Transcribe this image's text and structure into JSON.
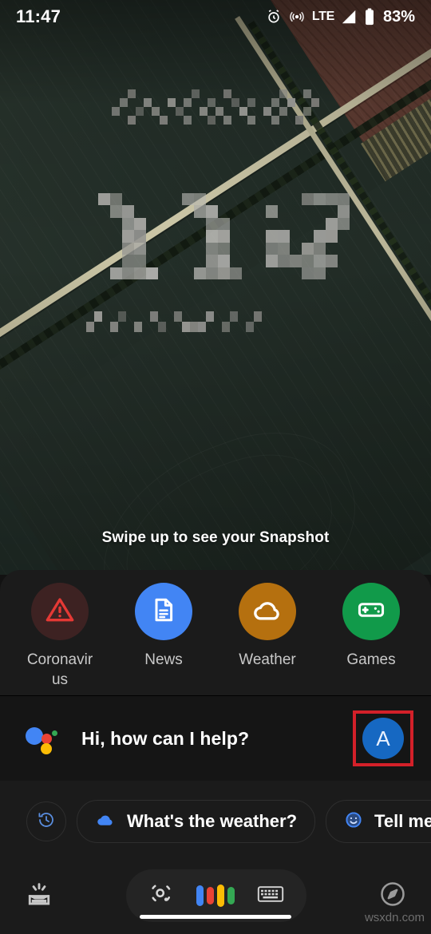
{
  "status_bar": {
    "time": "11:47",
    "battery_percent": "83%",
    "network_label": "LTE",
    "icons": [
      "alarm-icon",
      "hotspot-icon",
      "signal-icon",
      "battery-icon"
    ]
  },
  "lockscreen": {
    "clock_text": "11:47",
    "clock_blurred": true,
    "top_line_blurred": true,
    "bottom_line_blurred": true,
    "snapshot_hint": "Swipe up to see your Snapshot"
  },
  "shortcuts": [
    {
      "label": "Coronavirus",
      "icon": "warning-triangle-icon",
      "circle_color": "#3d2222",
      "icon_color": "#e53935"
    },
    {
      "label": "News",
      "icon": "document-icon",
      "circle_color": "#4285f4",
      "icon_color": "#ffffff"
    },
    {
      "label": "Weather",
      "icon": "cloud-icon",
      "circle_color": "#b5700f",
      "icon_color": "#ffffff"
    },
    {
      "label": "Games",
      "icon": "gamepad-icon",
      "circle_color": "#119a4a",
      "icon_color": "#ffffff"
    }
  ],
  "assistant": {
    "greeting": "Hi, how can I help?",
    "logo": "google-assistant-icon",
    "avatar_letter": "A",
    "avatar_color": "#1668c2",
    "highlight_color": "#d32029"
  },
  "suggestions": {
    "history_icon": "history-icon",
    "chips": [
      {
        "label": "What's the weather?",
        "icon": "cloud-icon",
        "icon_color": "#4285f4"
      },
      {
        "label": "Tell me",
        "icon": "smiley-icon",
        "icon_color": "#4285f4"
      }
    ]
  },
  "bottom_bar": {
    "left_icon": "snapshot-tray-icon",
    "right_icon": "explore-compass-icon",
    "pill": {
      "lens_icon": "google-lens-icon",
      "mic_icon": "assistant-mic-bars-icon",
      "keyboard_icon": "keyboard-icon",
      "mic_bar_colors": [
        "#4285f4",
        "#ea4335",
        "#fbbc05",
        "#34a853"
      ]
    }
  },
  "watermark": "wsxdn.com"
}
